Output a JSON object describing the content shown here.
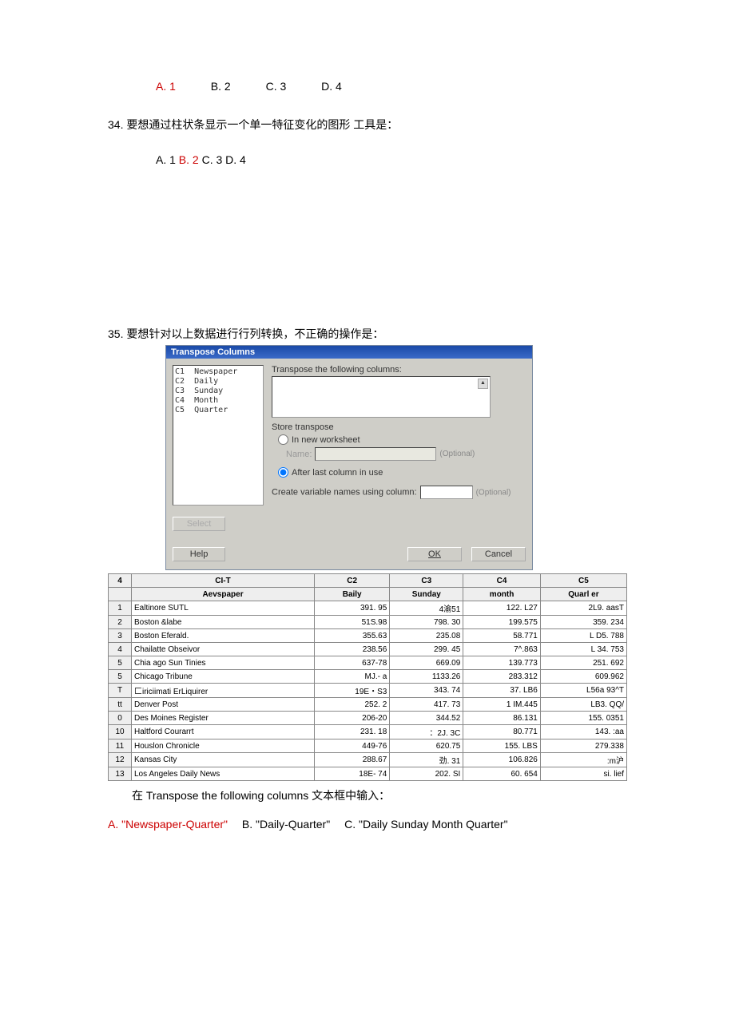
{
  "line1": {
    "a": "A. 1",
    "b": "B. 2",
    "c": "C. 3",
    "d": "D. 4"
  },
  "q34": {
    "num": "34.",
    "text": "要想通过柱状条显示一个单一特征变化的图形 工具是：",
    "a": "A.  1",
    "b": "B. 2",
    "c": "C. 3 D. 4"
  },
  "q35": {
    "num": "35.",
    "text": "要想针对以上数据进行行列转换，不正确的操作是："
  },
  "dlg": {
    "title": "Transpose Columns",
    "list": [
      [
        "C1",
        "Newspaper"
      ],
      [
        "C2",
        "Daily"
      ],
      [
        "C3",
        "Sunday"
      ],
      [
        "C4",
        "Month"
      ],
      [
        "C5",
        "Quarter"
      ]
    ],
    "trlabel": "Transpose the following columns:",
    "store": "Store transpose",
    "r1": "In new worksheet",
    "name": "Name:",
    "opt": "(Optional)",
    "r2": "After last column in use",
    "cvn": "Create variable names using column:",
    "select": "Select",
    "help": "Help",
    "ok": "OK",
    "cancel": "Cancel"
  },
  "tbl": {
    "corner": "4",
    "h": [
      "CI-T",
      "C2",
      "C3",
      "C4",
      "C5"
    ],
    "sub": [
      "Aevspaper",
      "Baily",
      "Sunday",
      "month",
      "Quarl er"
    ],
    "rows": [
      [
        "1",
        "Ealtinore SUTL",
        "391. 95",
        "4渝51",
        "122. L27",
        "2L9. aasT"
      ],
      [
        "2",
        "Boston &labe",
        "51S.98",
        "798. 30",
        "199.575",
        "359. 234"
      ],
      [
        "3",
        "Boston Eferald.",
        "355.63",
        "235.08",
        "58.771",
        "L D5. 788"
      ],
      [
        "4",
        "Chailatte Obseivor",
        "238.56",
        "299. 45",
        "7^.863",
        "L 34. 753"
      ],
      [
        "5",
        "Chia ago Sun Tinies",
        "637-78",
        "669.09",
        "139.773",
        "251. 692"
      ],
      [
        "5",
        "Chicago Tribune",
        "MJ.- a",
        "1133.26",
        "283.312",
        "609.962"
      ],
      [
        "T",
        "匚iriciimati ErLiquirer",
        "19E・S3",
        "343. 74",
        "37. LB6",
        "L56a 93^T"
      ],
      [
        "tt",
        "Denver Post",
        "252. 2",
        "417. 73",
        "1 IM.445",
        "LB3. QQ/"
      ],
      [
        "0",
        "Des Moines Register",
        "206-20",
        "344.52",
        "86.131",
        "155. 0351"
      ],
      [
        "10",
        "Haltford Courarrt",
        "231. 18",
        "：2J. 3C",
        "80.771",
        "143. :aa"
      ],
      [
        "11",
        "Houslon Chronicle",
        "449-76",
        "620.75",
        "155. LBS",
        "279.338"
      ],
      [
        "12",
        "Kansas City",
        "288.67",
        "劲. 31",
        "106.826",
        ":m沪"
      ],
      [
        "13",
        "Los Angeles Daily News",
        "18E- 74",
        "202. SI",
        "60. 654",
        "si. lief"
      ]
    ]
  },
  "after": {
    "p": "在 Transpose the following columns 文本框中输入：",
    "a": "A. \"Newspaper-Quarter\"",
    "b": "B. \"Daily-Quarter\"",
    "c": "C. \"Daily Sunday Month Quarter\""
  }
}
